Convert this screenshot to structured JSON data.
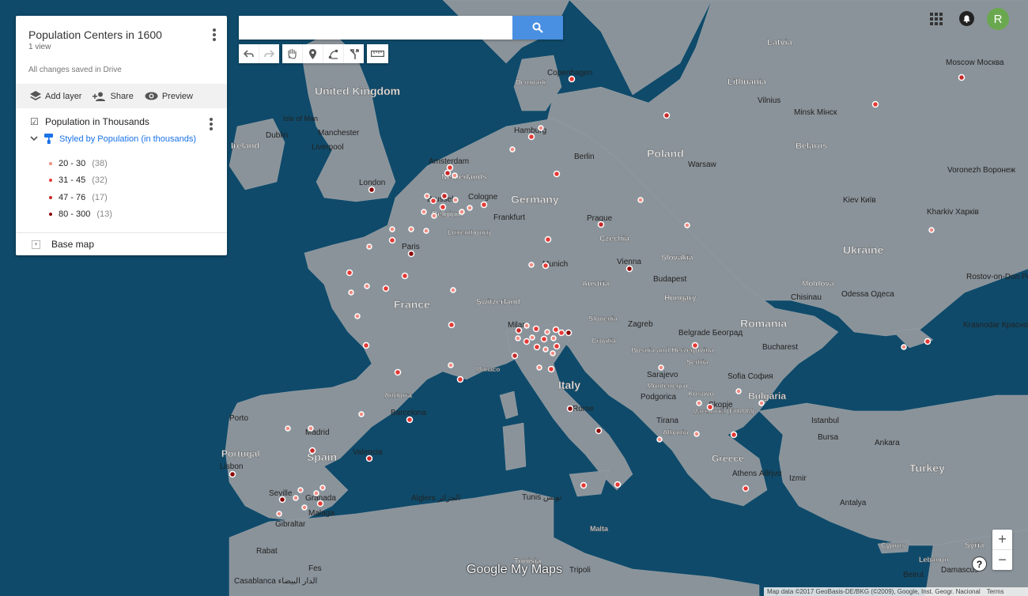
{
  "panel": {
    "title": "Population Centers in 1600",
    "views": "1 view",
    "saved": "All changes saved in Drive",
    "add_layer": "Add layer",
    "share": "Share",
    "preview": "Preview",
    "layer_name": "Population in Thousands",
    "styled_by": "Styled by Population (in thousands)",
    "legend": [
      {
        "range": "20 - 30",
        "count": "(38)",
        "color": "#f28b82"
      },
      {
        "range": "31 - 45",
        "count": "(32)",
        "color": "#e53935"
      },
      {
        "range": "47 - 76",
        "count": "(17)",
        "color": "#c62828"
      },
      {
        "range": "80 - 300",
        "count": "(13)",
        "color": "#8b0000"
      }
    ],
    "base_map": "Base map"
  },
  "search": {
    "value": "",
    "placeholder": ""
  },
  "user": {
    "initial": "R",
    "avatar_color": "#6aa84f"
  },
  "branding": "Google My Maps",
  "attribution": {
    "map_data": "Map data ©2017 GeoBasis-DE/BKG (©2009), Google, Inst. Geogr. Nacional",
    "terms": "Terms"
  },
  "icons": [
    "layers-icon",
    "add-person-icon",
    "eye-icon",
    "paint-roller-icon",
    "search-icon",
    "undo-icon",
    "redo-icon",
    "hand-icon",
    "marker-icon",
    "draw-line-icon",
    "directions-icon",
    "ruler-icon",
    "apps-grid-icon",
    "bell-icon",
    "zoom-in-icon",
    "zoom-out-icon",
    "help-icon"
  ],
  "map_labels": {
    "countries": [
      "United Kingdom",
      "Ireland",
      "France",
      "Germany",
      "Poland",
      "Belarus",
      "Ukraine",
      "Lithuania",
      "Latvia",
      "Czechia",
      "Slovakia",
      "Austria",
      "Hungary",
      "Romania",
      "Moldova",
      "Switzerland",
      "Spain",
      "Portugal",
      "Italy",
      "Bulgaria",
      "Greece",
      "Turkey",
      "Netherlands",
      "Belgium",
      "Luxembourg",
      "Denmark",
      "Slovenia",
      "Croatia",
      "Bosnia and Herzegovina",
      "Serbia",
      "Montenegro",
      "Kosovo",
      "Albania",
      "Macedonia (FYROM)",
      "Andorra",
      "Monaco",
      "Malta",
      "Tunisia",
      "Cyprus",
      "Syria",
      "Lebanon"
    ],
    "cities": [
      "Copenhagen",
      "Hamburg",
      "Berlin",
      "Warsaw",
      "Vilnius",
      "Minsk Мінск",
      "Moscow Москва",
      "Kiev Київ",
      "Kharkiv Харків",
      "Voronezh Воронеж",
      "Rostov-on-Don Ростов-на-Дону",
      "Krasnodar Краснодар",
      "Odessa Одеса",
      "Chisinau",
      "Bucharest",
      "Sofia София",
      "Belgrade Београд",
      "Sarajevo",
      "Podgorica",
      "Tirana",
      "Skopje",
      "Athens Αθήνα",
      "Istanbul",
      "Bursa",
      "Izmir",
      "Ankara",
      "Antalya",
      "Budapest",
      "Vienna",
      "Zagreb",
      "Prague",
      "Munich",
      "Milan",
      "Rome",
      "Frankfurt",
      "Cologne",
      "Brussels",
      "Amsterdam",
      "London",
      "Paris",
      "Dublin",
      "Manchester",
      "Liverpool",
      "Isle of Man",
      "Barcelona",
      "Madrid",
      "Valencia",
      "Seville",
      "Granada",
      "Malaga",
      "Gibraltar",
      "Porto",
      "Lisbon",
      "Algiers الجزائر",
      "Tunis تونس",
      "Tripoli",
      "Rabat",
      "Casablanca الدار البيضاء",
      "Beirut",
      "Damascus",
      "Fes"
    ]
  }
}
